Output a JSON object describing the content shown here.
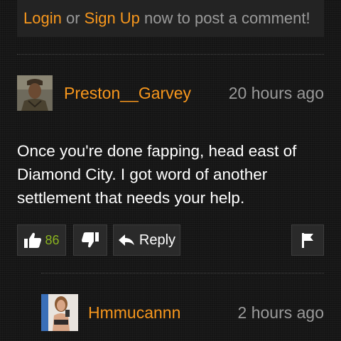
{
  "login_bar": {
    "login_label": "Login",
    "or_text": " or ",
    "signup_label": "Sign Up",
    "suffix_text": " now to post a comment!"
  },
  "comments": [
    {
      "username": "Preston__Garvey",
      "timestamp": "20 hours ago",
      "body": "Once you're done fapping, head east of Diamond City. I got word of another settlement that needs your help.",
      "likes": "86",
      "reply_label": "Reply",
      "icons": [
        "thumbs-up-icon",
        "thumbs-down-icon",
        "reply-arrow-icon",
        "flag-icon"
      ]
    },
    {
      "username": "Hmmucannn",
      "timestamp": "2 hours ago"
    }
  ],
  "colors": {
    "accent": "#f7971d",
    "muted_text": "#9a9a9a",
    "like_count": "#8ab31f",
    "background": "#141414",
    "button_bg": "#2a2a2a"
  }
}
